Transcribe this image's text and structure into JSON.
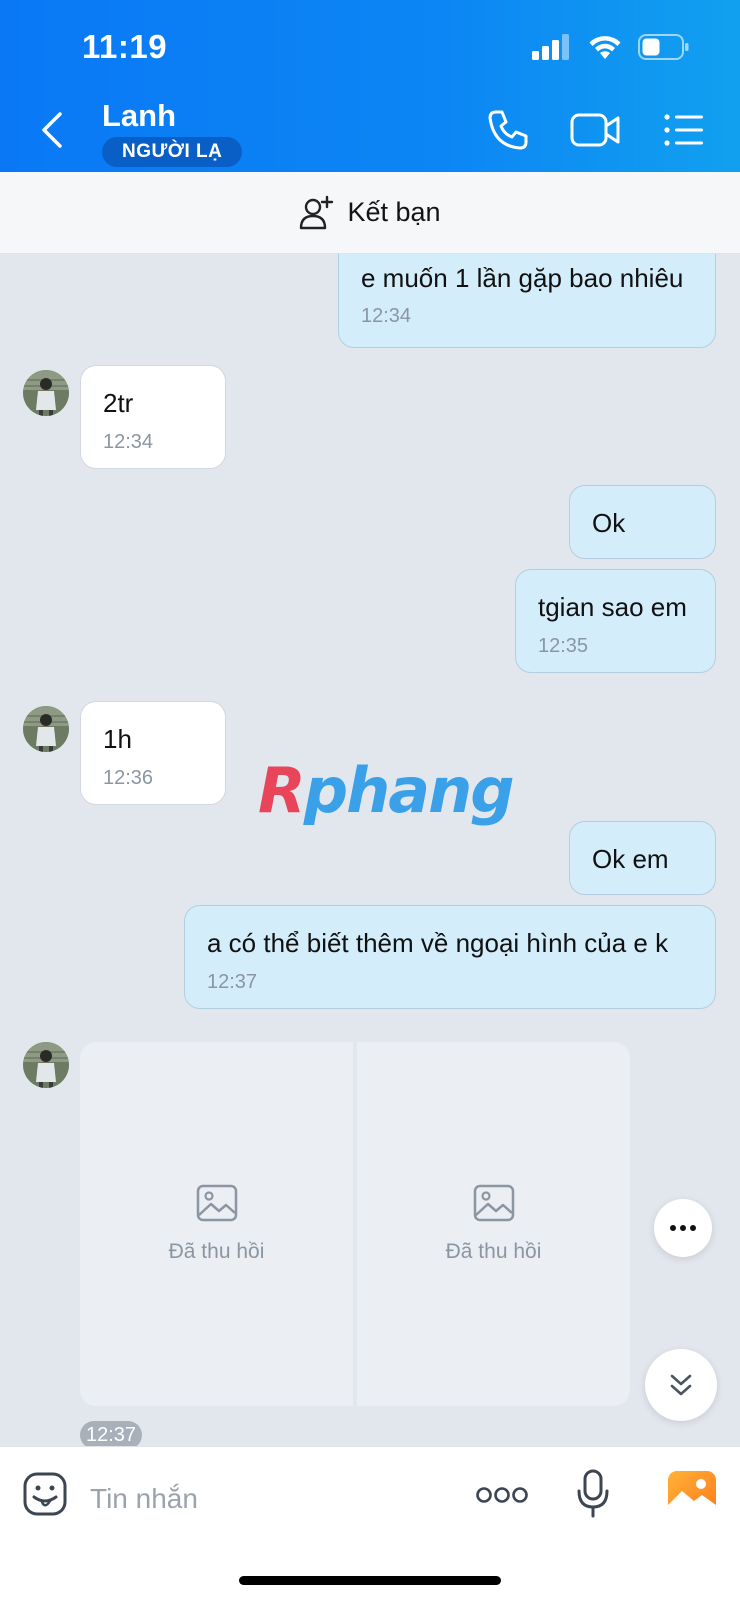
{
  "status_bar": {
    "time": "11:19"
  },
  "header": {
    "contact_name": "Lanh",
    "badge": "NGƯỜI LẠ",
    "icons": [
      "back-icon",
      "phone-icon",
      "video-call-icon",
      "menu-list-icon"
    ]
  },
  "add_friend": {
    "label": "Kết bạn",
    "icon": "add-user-icon"
  },
  "messages": [
    {
      "direction": "outgoing",
      "text": "e muốn 1 lần gặp bao nhiêu",
      "time": "12:34"
    },
    {
      "direction": "incoming",
      "text": "2tr",
      "time": "12:34"
    },
    {
      "direction": "outgoing",
      "text": "Ok",
      "time": ""
    },
    {
      "direction": "outgoing",
      "text": "tgian sao em",
      "time": "12:35"
    },
    {
      "direction": "incoming",
      "text": "1h",
      "time": "12:36"
    },
    {
      "direction": "outgoing",
      "text": "Ok em",
      "time": ""
    },
    {
      "direction": "outgoing",
      "text": "a có thể biết thêm về ngoại hình của e k",
      "time": "12:37"
    }
  ],
  "media_message": {
    "direction": "incoming",
    "items": [
      {
        "icon": "image-icon",
        "label": "Đã thu hồi"
      },
      {
        "icon": "image-icon",
        "label": "Đã thu hồi"
      }
    ],
    "time": "12:37"
  },
  "watermark": {
    "first": "R",
    "rest": "phang"
  },
  "input_bar": {
    "placeholder": "Tin nhắn",
    "icons": [
      "sticker-icon",
      "more-dots-icon",
      "microphone-icon",
      "photo-gallery-icon"
    ]
  },
  "colors": {
    "header_gradient_start": "#0a78f5",
    "header_gradient_end": "#11a0ef",
    "outgoing_bubble": "#d4edfb",
    "incoming_bubble": "#ffffff",
    "chat_background": "#e2e7ee"
  }
}
